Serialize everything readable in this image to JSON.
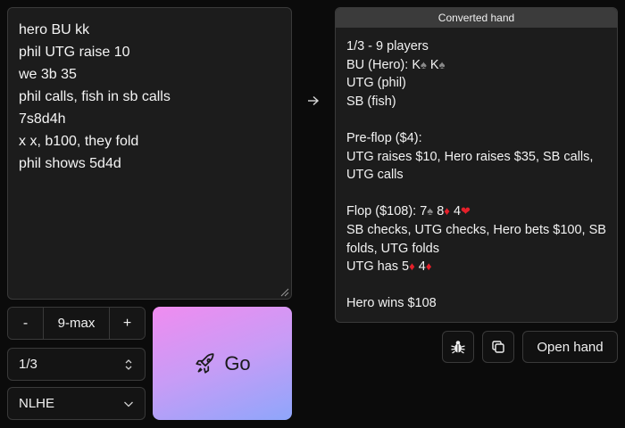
{
  "input": {
    "lines": [
      "hero BU kk",
      "phil UTG raise 10",
      "we 3b 35",
      "phil calls, fish in sb calls",
      "7s8d4h",
      "x x, b100, they fold",
      "phil shows 5d4d"
    ]
  },
  "output": {
    "header": "Converted hand",
    "l1": "1/3 - 9 players",
    "l2a": "BU (Hero): K",
    "l2b": " K",
    "l3": "UTG (phil)",
    "l4": "SB (fish)",
    "l5": "Pre-flop ($4):",
    "l6": "UTG raises $10, Hero raises $35, SB calls,",
    "l7": "UTG calls",
    "l8a": "Flop ($108): 7",
    "l8b": " 8",
    "l8c": " 4",
    "l9": "SB checks, UTG checks, Hero bets $100, SB",
    "l10": "folds, UTG folds",
    "l11a": "UTG has 5",
    "l11b": " 4",
    "l12": "Hero wins $108",
    "suits": {
      "spade": "♠",
      "diamond": "♦",
      "heart": "❤"
    }
  },
  "controls": {
    "minus": "-",
    "table_size": "9-max",
    "plus": "+",
    "stakes": "1/3",
    "game": "NLHE",
    "go_label": "Go",
    "open_hand": "Open hand"
  },
  "colors": {
    "suit_black": "#8a8a8a",
    "suit_red": "#e5202a",
    "go_gradient_start": "#f08cf0",
    "go_gradient_end": "#8ea6fb"
  }
}
